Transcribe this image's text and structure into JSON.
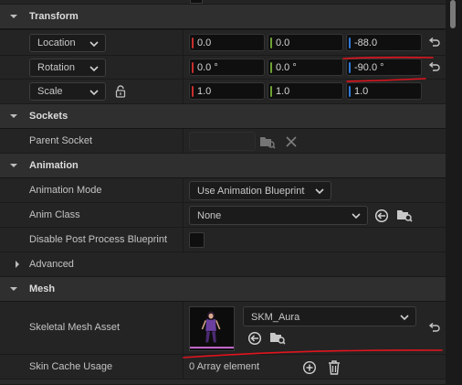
{
  "transform": {
    "title": "Transform",
    "location": {
      "mode": "Location",
      "x": "0.0",
      "y": "0.0",
      "z": "-88.0"
    },
    "rotation": {
      "mode": "Rotation",
      "x": "0.0 °",
      "y": "0.0 °",
      "z": "-90.0 °"
    },
    "scale": {
      "mode": "Scale",
      "x": "1.0",
      "y": "1.0",
      "z": "1.0"
    }
  },
  "sockets": {
    "title": "Sockets",
    "parent_socket_label": "Parent Socket",
    "parent_socket_value": ""
  },
  "animation": {
    "title": "Animation",
    "mode_label": "Animation Mode",
    "mode_value": "Use Animation Blueprint",
    "class_label": "Anim Class",
    "class_value": "None",
    "disable_pp_label": "Disable Post Process Blueprint",
    "disable_pp_checked": false
  },
  "advanced": {
    "title": "Advanced"
  },
  "mesh": {
    "title": "Mesh",
    "skeletal_label": "Skeletal Mesh Asset",
    "skeletal_value": "SKM_Aura",
    "skin_cache_label": "Skin Cache Usage",
    "skin_cache_value": "0 Array element"
  },
  "colors": {
    "x_axis": "#c8302e",
    "y_axis": "#6ea233",
    "z_axis": "#2f7ad8",
    "annotation": "#e0141e"
  },
  "icons": [
    "chevron-down-icon",
    "reset-arrow-icon",
    "lock-icon",
    "browse-folder-icon",
    "clear-x-icon",
    "use-selected-arrow-icon",
    "add-plus-icon",
    "trash-icon",
    "chevron-right-icon"
  ]
}
